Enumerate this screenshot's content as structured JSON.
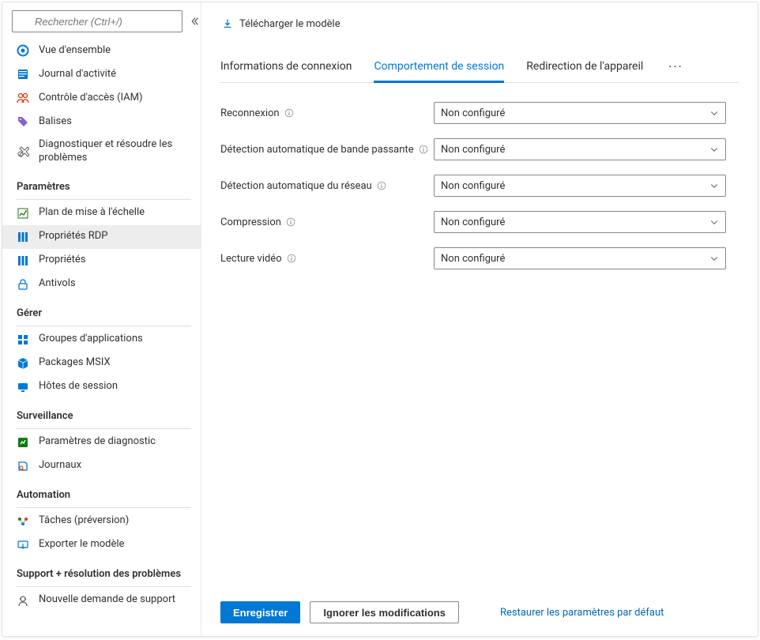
{
  "search": {
    "placeholder": "Rechercher (Ctrl+/)"
  },
  "nav": {
    "overview": "Vue d'ensemble",
    "activity": "Journal d'activité",
    "iam": "Contrôle d'accès (IAM)",
    "tags": "Balises",
    "diagnose": "Diagnostiquer et résoudre les problèmes"
  },
  "sections": {
    "settings": "Paramètres",
    "manage": "Gérer",
    "monitoring": "Surveillance",
    "automation": "Automation",
    "support": "Support + résolution des problèmes"
  },
  "settings": {
    "scaling": "Plan de mise à l'échelle",
    "rdp": "Propriétés RDP",
    "props": "Propriétés",
    "locks": "Antivols"
  },
  "manage": {
    "appgroups": "Groupes d'applications",
    "msix": "Packages MSIX",
    "sessionhosts": "Hôtes de session"
  },
  "monitoring": {
    "diag": "Paramètres de diagnostic",
    "logs": "Journaux"
  },
  "automation": {
    "tasks": "Tâches (préversion)",
    "export": "Exporter le modèle"
  },
  "support": {
    "newreq": "Nouvelle demande de support"
  },
  "toolbar": {
    "download": "Télécharger le modèle"
  },
  "tabs": {
    "conn": "Informations de connexion",
    "session": "Comportement de session",
    "device": "Redirection de l'appareil"
  },
  "form": {
    "reconnect": "Reconnexion",
    "bandwidth": "Détection automatique de bande passante",
    "network": "Détection automatique du réseau",
    "compression": "Compression",
    "video": "Lecture vidéo",
    "value": "Non configuré"
  },
  "footer": {
    "save": "Enregistrer",
    "discard": "Ignorer les modifications",
    "restore": "Restaurer les paramètres par défaut"
  }
}
